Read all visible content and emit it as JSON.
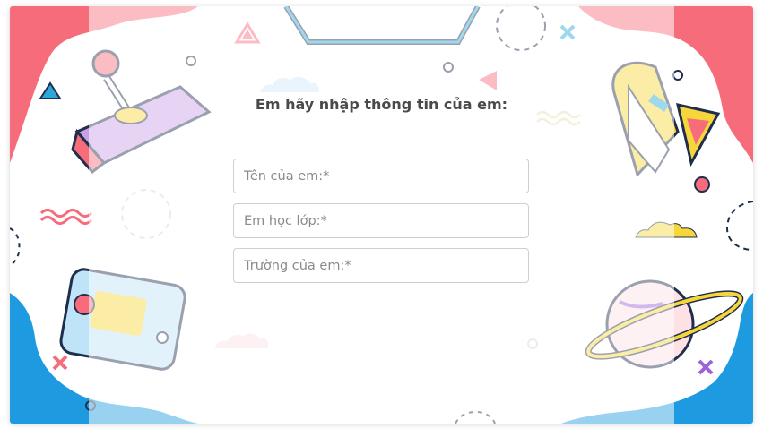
{
  "form": {
    "title": "Em hãy nhập thông tin của em:",
    "fields": [
      {
        "placeholder": "Tên của em:*",
        "value": ""
      },
      {
        "placeholder": "Em học lớp:*",
        "value": ""
      },
      {
        "placeholder": "Trường của em:*",
        "value": ""
      }
    ]
  },
  "colors": {
    "pink": "#f76c7b",
    "blue": "#1e9be0",
    "navy": "#1f2e4d",
    "yellow": "#f7d63b",
    "purple": "#9b64d8",
    "teal": "#2ba8d8"
  },
  "decorations": [
    "joystick-icon",
    "rocket-icon",
    "game-console-icon",
    "planet-icon",
    "hexagon-frame",
    "cloud-icon",
    "wave-squiggle-icon",
    "triangle-icon",
    "cross-icon",
    "circle-icon"
  ]
}
